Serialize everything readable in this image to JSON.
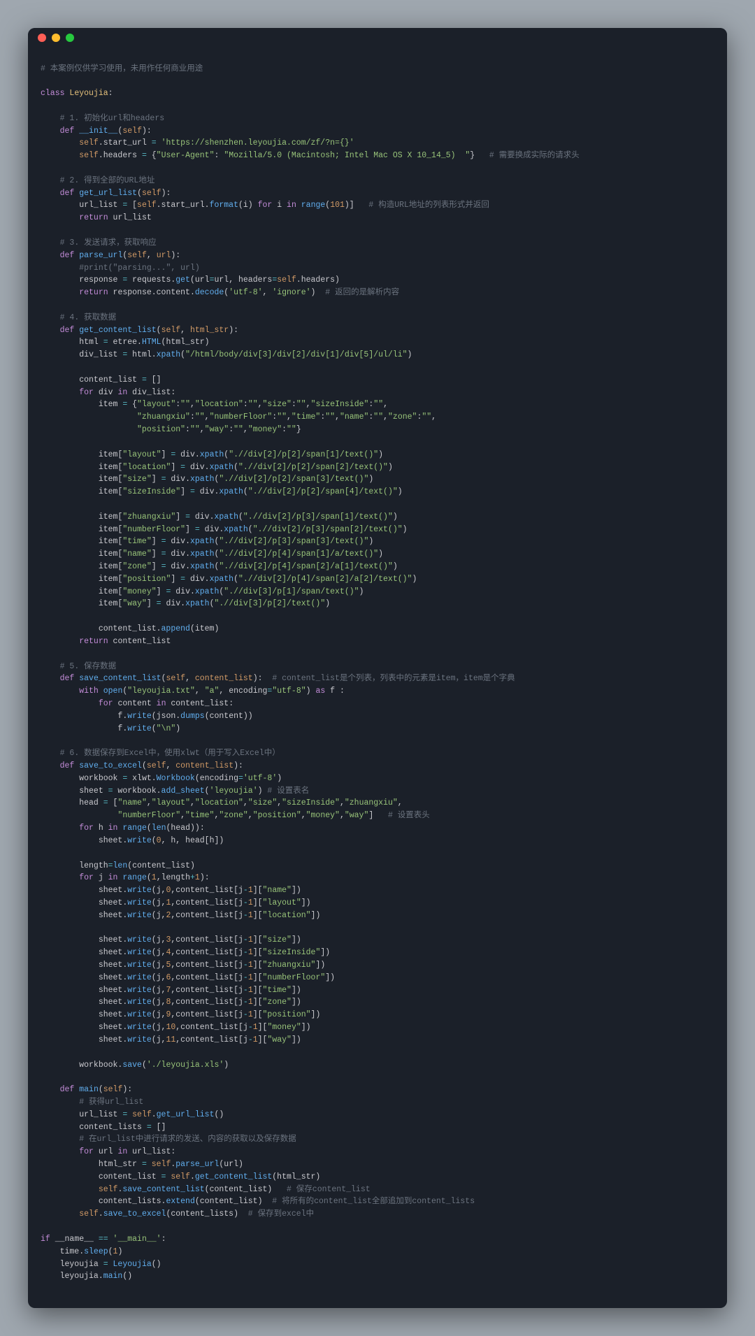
{
  "window": {
    "type": "macos-terminal"
  },
  "code_lines": [
    "<span class='cm'># 本案例仅供学习使用，未用作任何商业用途</span>",
    "",
    "<span class='kw'>class</span> <span class='cls'>Leyoujia</span>:",
    "",
    "    <span class='cm'># 1. 初始化url和headers</span>",
    "    <span class='kw'>def</span> <span class='fn'>__init__</span>(<span class='sf'>self</span>):",
    "        <span class='sf'>self</span>.start_url <span class='op'>=</span> <span class='st'>'https://shenzhen.leyoujia.com/zf/?n={}'</span>",
    "        <span class='sf'>self</span>.headers <span class='op'>=</span> {<span class='st'>\"User-Agent\"</span>: <span class='st'>\"Mozilla/5.0 (Macintosh; Intel Mac OS X 10_14_5)  \"</span>}   <span class='cm'># 需要换成实际的请求头</span>",
    "",
    "    <span class='cm'># 2. 得到全部的URL地址</span>",
    "    <span class='kw'>def</span> <span class='fn'>get_url_list</span>(<span class='sf'>self</span>):",
    "        url_list <span class='op'>=</span> [<span class='sf'>self</span>.start_url.<span class='fn'>format</span>(i) <span class='kw'>for</span> i <span class='kw'>in</span> <span class='fn'>range</span>(<span class='nm'>101</span>)]   <span class='cm'># 构造URL地址的列表形式并返回</span>",
    "        <span class='kw'>return</span> url_list",
    "",
    "    <span class='cm'># 3. 发送请求，获取响应</span>",
    "    <span class='kw'>def</span> <span class='fn'>parse_url</span>(<span class='sf'>self</span>, <span class='sf'>url</span>):",
    "        <span class='cm'>#print(\"parsing...\", url)</span>",
    "        response <span class='op'>=</span> requests.<span class='fn'>get</span>(url<span class='op'>=</span>url, headers<span class='op'>=</span><span class='sf'>self</span>.headers)",
    "        <span class='kw'>return</span> response.content.<span class='fn'>decode</span>(<span class='st'>'utf-8'</span>, <span class='st'>'ignore'</span>)  <span class='cm'># 返回的是解析内容</span>",
    "",
    "    <span class='cm'># 4. 获取数据</span>",
    "    <span class='kw'>def</span> <span class='fn'>get_content_list</span>(<span class='sf'>self</span>, <span class='sf'>html_str</span>):",
    "        html <span class='op'>=</span> etree.<span class='fn'>HTML</span>(html_str)",
    "        div_list <span class='op'>=</span> html.<span class='fn'>xpath</span>(<span class='st'>\"/html/body/div[3]/div[2]/div[1]/div[5]/ul/li\"</span>)",
    "",
    "        content_list <span class='op'>=</span> []",
    "        <span class='kw'>for</span> div <span class='kw'>in</span> div_list:",
    "            item <span class='op'>=</span> {<span class='st'>\"layout\"</span>:<span class='st'>\"\"</span>,<span class='st'>\"location\"</span>:<span class='st'>\"\"</span>,<span class='st'>\"size\"</span>:<span class='st'>\"\"</span>,<span class='st'>\"sizeInside\"</span>:<span class='st'>\"\"</span>,",
    "                    <span class='st'>\"zhuangxiu\"</span>:<span class='st'>\"\"</span>,<span class='st'>\"numberFloor\"</span>:<span class='st'>\"\"</span>,<span class='st'>\"time\"</span>:<span class='st'>\"\"</span>,<span class='st'>\"name\"</span>:<span class='st'>\"\"</span>,<span class='st'>\"zone\"</span>:<span class='st'>\"\"</span>,",
    "                    <span class='st'>\"position\"</span>:<span class='st'>\"\"</span>,<span class='st'>\"way\"</span>:<span class='st'>\"\"</span>,<span class='st'>\"money\"</span>:<span class='st'>\"\"</span>}",
    "",
    "            item[<span class='st'>\"layout\"</span>] <span class='op'>=</span> div.<span class='fn'>xpath</span>(<span class='st'>\".//div[2]/p[2]/span[1]/text()\"</span>)",
    "            item[<span class='st'>\"location\"</span>] <span class='op'>=</span> div.<span class='fn'>xpath</span>(<span class='st'>\".//div[2]/p[2]/span[2]/text()\"</span>)",
    "            item[<span class='st'>\"size\"</span>] <span class='op'>=</span> div.<span class='fn'>xpath</span>(<span class='st'>\".//div[2]/p[2]/span[3]/text()\"</span>)",
    "            item[<span class='st'>\"sizeInside\"</span>] <span class='op'>=</span> div.<span class='fn'>xpath</span>(<span class='st'>\".//div[2]/p[2]/span[4]/text()\"</span>)",
    "",
    "            item[<span class='st'>\"zhuangxiu\"</span>] <span class='op'>=</span> div.<span class='fn'>xpath</span>(<span class='st'>\".//div[2]/p[3]/span[1]/text()\"</span>)",
    "            item[<span class='st'>\"numberFloor\"</span>] <span class='op'>=</span> div.<span class='fn'>xpath</span>(<span class='st'>\".//div[2]/p[3]/span[2]/text()\"</span>)",
    "            item[<span class='st'>\"time\"</span>] <span class='op'>=</span> div.<span class='fn'>xpath</span>(<span class='st'>\".//div[2]/p[3]/span[3]/text()\"</span>)",
    "            item[<span class='st'>\"name\"</span>] <span class='op'>=</span> div.<span class='fn'>xpath</span>(<span class='st'>\".//div[2]/p[4]/span[1]/a/text()\"</span>)",
    "            item[<span class='st'>\"zone\"</span>] <span class='op'>=</span> div.<span class='fn'>xpath</span>(<span class='st'>\".//div[2]/p[4]/span[2]/a[1]/text()\"</span>)",
    "            item[<span class='st'>\"position\"</span>] <span class='op'>=</span> div.<span class='fn'>xpath</span>(<span class='st'>\".//div[2]/p[4]/span[2]/a[2]/text()\"</span>)",
    "            item[<span class='st'>\"money\"</span>] <span class='op'>=</span> div.<span class='fn'>xpath</span>(<span class='st'>\".//div[3]/p[1]/span/text()\"</span>)",
    "            item[<span class='st'>\"way\"</span>] <span class='op'>=</span> div.<span class='fn'>xpath</span>(<span class='st'>\".//div[3]/p[2]/text()\"</span>)",
    "",
    "            content_list.<span class='fn'>append</span>(item)",
    "        <span class='kw'>return</span> content_list",
    "",
    "    <span class='cm'># 5. 保存数据</span>",
    "    <span class='kw'>def</span> <span class='fn'>save_content_list</span>(<span class='sf'>self</span>, <span class='sf'>content_list</span>):  <span class='cm'># content_list是个列表，列表中的元素是item，item是个字典</span>",
    "        <span class='kw'>with</span> <span class='fn'>open</span>(<span class='st'>\"leyoujia.txt\"</span>, <span class='st'>\"a\"</span>, encoding<span class='op'>=</span><span class='st'>\"utf-8\"</span>) <span class='kw'>as</span> f :",
    "            <span class='kw'>for</span> content <span class='kw'>in</span> content_list:",
    "                f.<span class='fn'>write</span>(json.<span class='fn'>dumps</span>(content))",
    "                f.<span class='fn'>write</span>(<span class='st'>\"\\n\"</span>)",
    "",
    "    <span class='cm'># 6. 数据保存到Excel中，使用xlwt（用于写入Excel中）</span>",
    "    <span class='kw'>def</span> <span class='fn'>save_to_excel</span>(<span class='sf'>self</span>, <span class='sf'>content_list</span>):",
    "        workbook <span class='op'>=</span> xlwt.<span class='fn'>Workbook</span>(encoding<span class='op'>=</span><span class='st'>'utf-8'</span>)",
    "        sheet <span class='op'>=</span> workbook.<span class='fn'>add_sheet</span>(<span class='st'>'leyoujia'</span>) <span class='cm'># 设置表名</span>",
    "        head <span class='op'>=</span> [<span class='st'>\"name\"</span>,<span class='st'>\"layout\"</span>,<span class='st'>\"location\"</span>,<span class='st'>\"size\"</span>,<span class='st'>\"sizeInside\"</span>,<span class='st'>\"zhuangxiu\"</span>,",
    "                <span class='st'>\"numberFloor\"</span>,<span class='st'>\"time\"</span>,<span class='st'>\"zone\"</span>,<span class='st'>\"position\"</span>,<span class='st'>\"money\"</span>,<span class='st'>\"way\"</span>]   <span class='cm'># 设置表头</span>",
    "        <span class='kw'>for</span> h <span class='kw'>in</span> <span class='fn'>range</span>(<span class='fn'>len</span>(head)):",
    "            sheet.<span class='fn'>write</span>(<span class='nm'>0</span>, h, head[h])",
    "",
    "        length<span class='op'>=</span><span class='fn'>len</span>(content_list)",
    "        <span class='kw'>for</span> j <span class='kw'>in</span> <span class='fn'>range</span>(<span class='nm'>1</span>,length<span class='op'>+</span><span class='nm'>1</span>):",
    "            sheet.<span class='fn'>write</span>(j,<span class='nm'>0</span>,content_list[j<span class='op'>-</span><span class='nm'>1</span>][<span class='st'>\"name\"</span>])",
    "            sheet.<span class='fn'>write</span>(j,<span class='nm'>1</span>,content_list[j<span class='op'>-</span><span class='nm'>1</span>][<span class='st'>\"layout\"</span>])",
    "            sheet.<span class='fn'>write</span>(j,<span class='nm'>2</span>,content_list[j<span class='op'>-</span><span class='nm'>1</span>][<span class='st'>\"location\"</span>])",
    "",
    "            sheet.<span class='fn'>write</span>(j,<span class='nm'>3</span>,content_list[j<span class='op'>-</span><span class='nm'>1</span>][<span class='st'>\"size\"</span>])",
    "            sheet.<span class='fn'>write</span>(j,<span class='nm'>4</span>,content_list[j<span class='op'>-</span><span class='nm'>1</span>][<span class='st'>\"sizeInside\"</span>])",
    "            sheet.<span class='fn'>write</span>(j,<span class='nm'>5</span>,content_list[j<span class='op'>-</span><span class='nm'>1</span>][<span class='st'>\"zhuangxiu\"</span>])",
    "            sheet.<span class='fn'>write</span>(j,<span class='nm'>6</span>,content_list[j<span class='op'>-</span><span class='nm'>1</span>][<span class='st'>\"numberFloor\"</span>])",
    "            sheet.<span class='fn'>write</span>(j,<span class='nm'>7</span>,content_list[j<span class='op'>-</span><span class='nm'>1</span>][<span class='st'>\"time\"</span>])",
    "            sheet.<span class='fn'>write</span>(j,<span class='nm'>8</span>,content_list[j<span class='op'>-</span><span class='nm'>1</span>][<span class='st'>\"zone\"</span>])",
    "            sheet.<span class='fn'>write</span>(j,<span class='nm'>9</span>,content_list[j<span class='op'>-</span><span class='nm'>1</span>][<span class='st'>\"position\"</span>])",
    "            sheet.<span class='fn'>write</span>(j,<span class='nm'>10</span>,content_list[j<span class='op'>-</span><span class='nm'>1</span>][<span class='st'>\"money\"</span>])",
    "            sheet.<span class='fn'>write</span>(j,<span class='nm'>11</span>,content_list[j<span class='op'>-</span><span class='nm'>1</span>][<span class='st'>\"way\"</span>])",
    "",
    "        workbook.<span class='fn'>save</span>(<span class='st'>'./leyoujia.xls'</span>)",
    "",
    "    <span class='kw'>def</span> <span class='fn'>main</span>(<span class='sf'>self</span>):",
    "        <span class='cm'># 获得url_list</span>",
    "        url_list <span class='op'>=</span> <span class='sf'>self</span>.<span class='fn'>get_url_list</span>()",
    "        content_lists <span class='op'>=</span> []",
    "        <span class='cm'># 在url_list中进行请求的发送、内容的获取以及保存数据</span>",
    "        <span class='kw'>for</span> url <span class='kw'>in</span> url_list:",
    "            html_str <span class='op'>=</span> <span class='sf'>self</span>.<span class='fn'>parse_url</span>(url)",
    "            content_list <span class='op'>=</span> <span class='sf'>self</span>.<span class='fn'>get_content_list</span>(html_str)",
    "            <span class='sf'>self</span>.<span class='fn'>save_content_list</span>(content_list)   <span class='cm'># 保存content_list</span>",
    "            content_lists.<span class='fn'>extend</span>(content_list)  <span class='cm'># 将所有的content_list全部追加到content_lists</span>",
    "        <span class='sf'>self</span>.<span class='fn'>save_to_excel</span>(content_lists)  <span class='cm'># 保存到excel中</span>",
    "",
    "<span class='kw'>if</span> __name__ <span class='op'>==</span> <span class='st'>'__main__'</span>:",
    "    time.<span class='fn'>sleep</span>(<span class='nm'>1</span>)",
    "    leyoujia <span class='op'>=</span> <span class='fn'>Leyoujia</span>()",
    "    leyoujia.<span class='fn'>main</span>()"
  ]
}
